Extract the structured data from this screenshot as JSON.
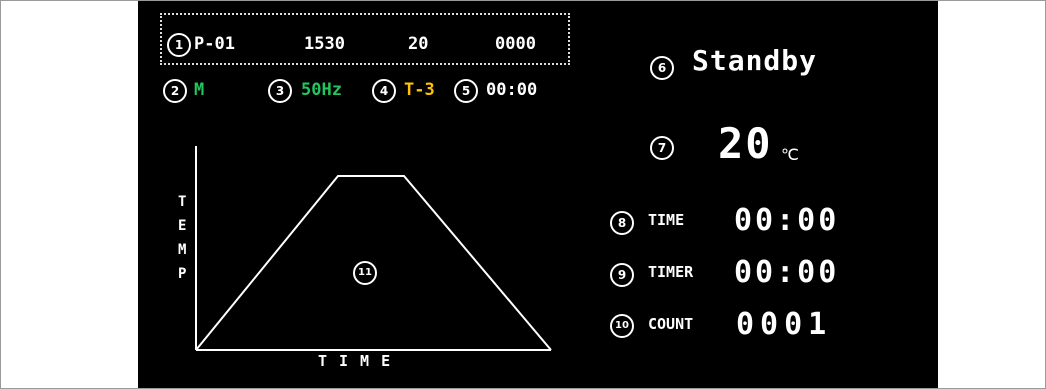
{
  "params": {
    "marker": "1",
    "program": "P-01",
    "value_a": "1530",
    "value_b": "20",
    "value_c": "0000"
  },
  "status_row": {
    "mode_marker": "2",
    "mode": "M",
    "freq_marker": "3",
    "freq": "50Hz",
    "temp_mode_marker": "4",
    "temp_mode": "T-3",
    "clock_marker": "5",
    "clock": "00:00"
  },
  "state": {
    "marker": "6",
    "text": "Standby"
  },
  "temperature": {
    "marker": "7",
    "value": "20",
    "unit": "℃"
  },
  "time": {
    "marker": "8",
    "label": "TIME",
    "value": "00:00"
  },
  "timer": {
    "marker": "9",
    "label": "TIMER",
    "value": "00:00"
  },
  "count": {
    "marker": "10",
    "label": "COUNT",
    "value": "0001"
  },
  "graph": {
    "marker": "11",
    "y_letters": [
      "T",
      "E",
      "M",
      "P"
    ],
    "x_label": "TIME",
    "colors": {
      "line": "#ffffff"
    }
  },
  "colors": {
    "screen_bg": "#000000",
    "mode_green": "#22c55e",
    "temp_mode_yellow": "#ffc107"
  }
}
